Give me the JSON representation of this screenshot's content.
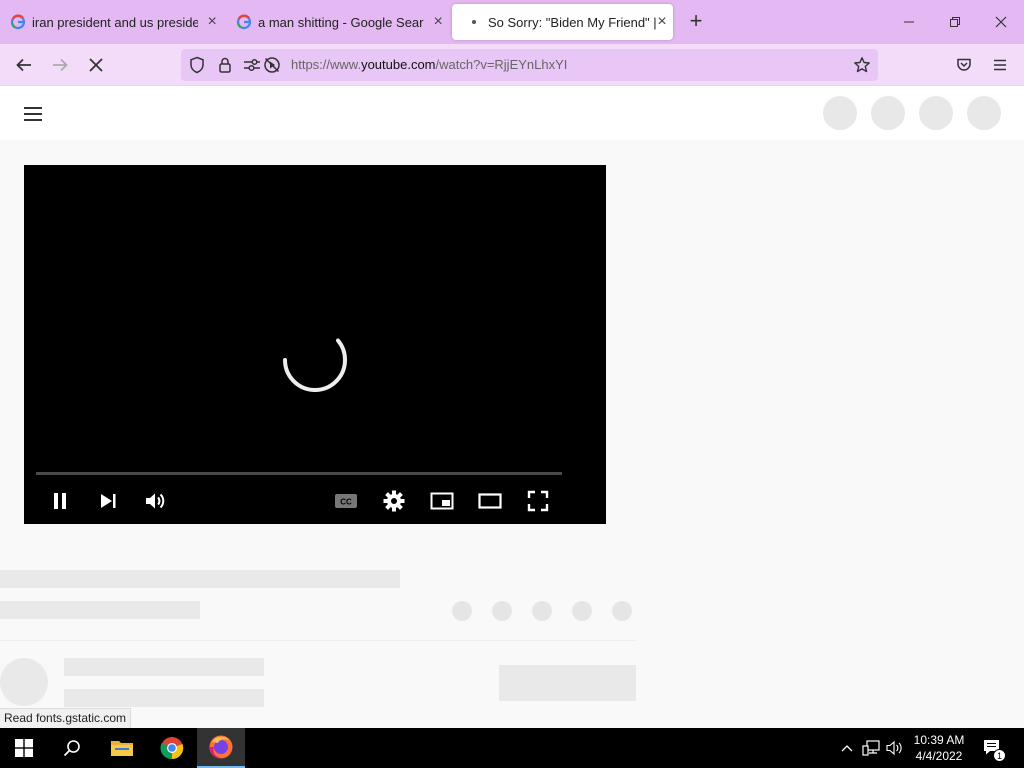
{
  "browser": {
    "tabs": [
      {
        "title": "iran president and us president",
        "close": "×",
        "active": false,
        "favicon": "google-g-icon"
      },
      {
        "title": "a man shitting - Google Search",
        "close": "×",
        "active": false,
        "favicon": "google-g-icon"
      },
      {
        "title": "So Sorry: \"Biden My Friend\" | PE",
        "close": "×",
        "active": true,
        "favicon": "loading-dot-icon"
      }
    ],
    "new_tab": "+",
    "url": {
      "prefix": "https://www.",
      "domain": "youtube.com",
      "path": "/watch?v=RjjEYnLhxYI"
    }
  },
  "page": {
    "status_text": "Read fonts.gstatic.com"
  },
  "taskbar": {
    "clock_time": "10:39 AM",
    "clock_date": "4/4/2022",
    "notification_count": "1"
  },
  "colors": {
    "tab_strip": "#e3b8f3",
    "nav_bar": "#f2dcfa",
    "url_field": "#e8c6f5"
  }
}
